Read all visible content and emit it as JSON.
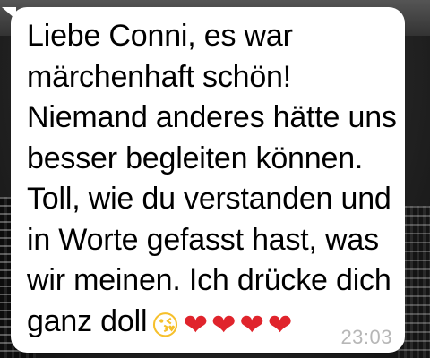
{
  "message": {
    "lines": [
      "Liebe Conni, es war",
      "märchenhaft schön!",
      "Niemand anderes hätte uns",
      "besser begleiten können.",
      "Toll, wie du verstanden und",
      "in Worte gefasst hast, was",
      "wir meinen. Ich drücke dich",
      "ganz doll"
    ],
    "emojis": {
      "kiss": "😘",
      "heart": "❤"
    },
    "time": "23:03"
  },
  "colors": {
    "bubble": "#ffffff",
    "text": "#000000",
    "timestamp": "#b7b7b7",
    "heart": "#e0242c"
  }
}
